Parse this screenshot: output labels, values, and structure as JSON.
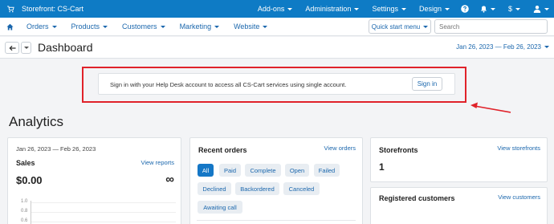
{
  "topbar": {
    "store_label": "Storefront: CS-Cart",
    "menus": [
      "Add-ons",
      "Administration",
      "Settings",
      "Design"
    ],
    "currency": "$"
  },
  "nav": {
    "items": [
      "Orders",
      "Products",
      "Customers",
      "Marketing",
      "Website"
    ],
    "quick_start": "Quick start menu",
    "search_placeholder": "Search"
  },
  "header": {
    "title": "Dashboard",
    "date_range": "Jan 26, 2023 — Feb 26, 2023"
  },
  "notice": {
    "text": "Sign in with your Help Desk account to access all CS-Cart services using single account.",
    "button": "Sign in"
  },
  "analytics": {
    "heading": "Analytics",
    "sales": {
      "date_range": "Jan 26, 2023 — Feb 26, 2023",
      "title": "Sales",
      "link": "View reports",
      "amount": "$0.00",
      "change": "∞",
      "y_ticks": [
        "1.0",
        "0.8",
        "0.6"
      ]
    },
    "recent_orders": {
      "title": "Recent orders",
      "link": "View orders",
      "filters": [
        "All",
        "Paid",
        "Complete",
        "Open",
        "Failed",
        "Declined",
        "Backordered",
        "Canceled",
        "Awaiting call"
      ]
    },
    "storefronts": {
      "title": "Storefronts",
      "link": "View storefronts",
      "count": "1"
    },
    "customers": {
      "title": "Registered customers",
      "link": "View customers"
    }
  },
  "colors": {
    "topbar": "#0e7bc5",
    "link": "#1b67ad",
    "highlight": "#e0222a",
    "active_filter": "#1577c6"
  }
}
